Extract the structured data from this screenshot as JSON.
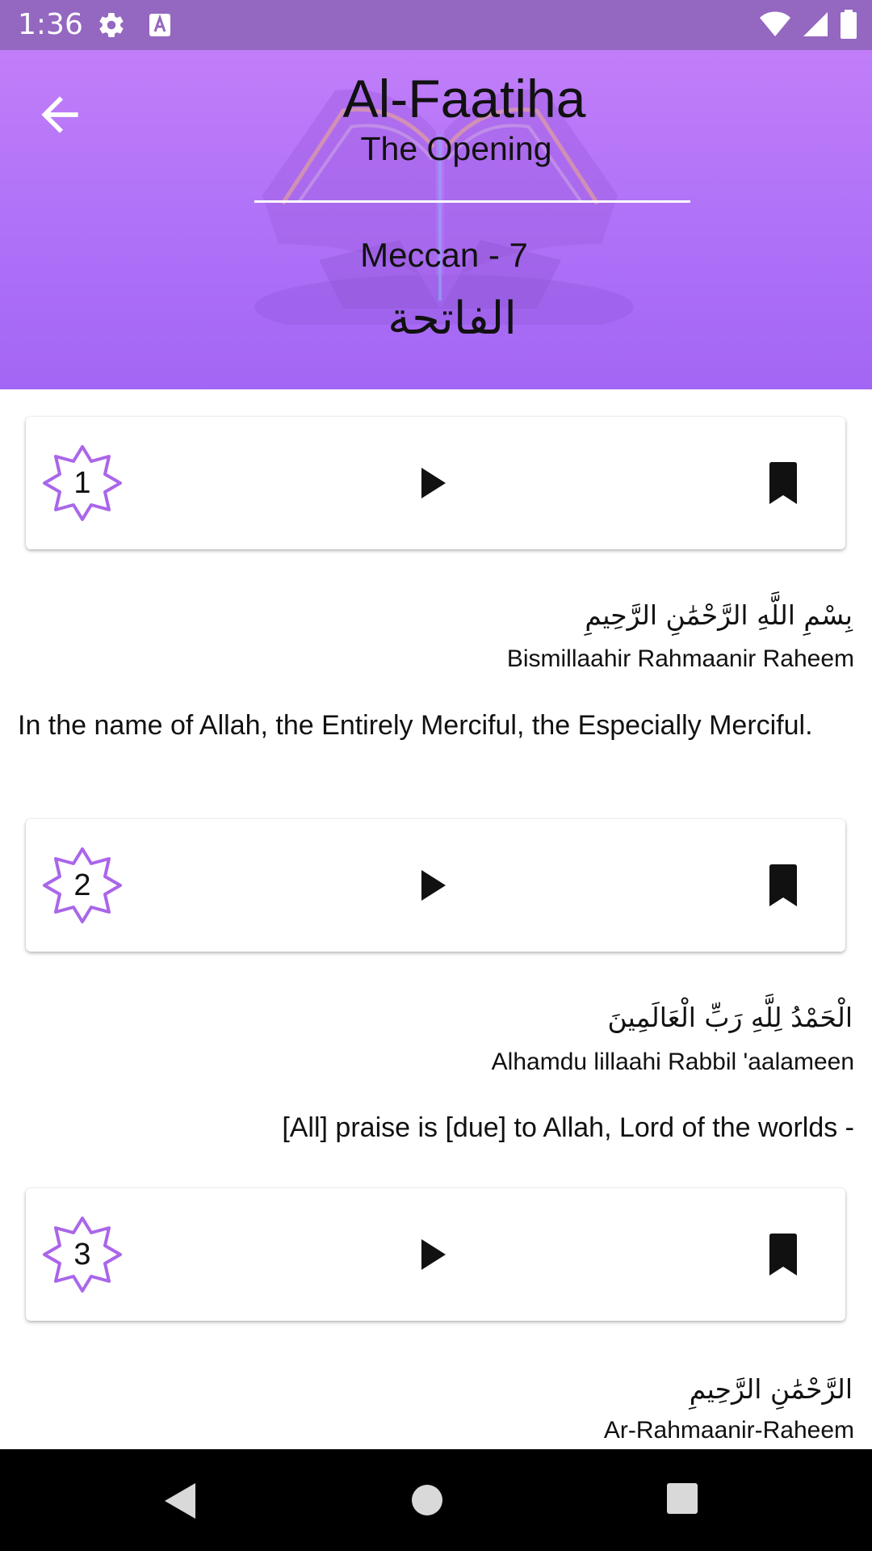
{
  "status_bar": {
    "time": "1:36",
    "icons": [
      "settings-icon",
      "keyboard-a-icon",
      "wifi-icon",
      "signal-icon",
      "battery-icon"
    ]
  },
  "header": {
    "title": "Al-Faatiha",
    "subtitle": "The Opening",
    "revelation_info": "Meccan - 7",
    "arabic_name": "الفاتحة",
    "back_icon": "arrow-back-icon",
    "background_icon": "open-book-icon"
  },
  "verses": [
    {
      "number": "1",
      "arabic": "بِسْمِ اللَّهِ الرَّحْمَٰنِ الرَّحِيمِ",
      "transliteration": "Bismillaahir Rahmaanir Raheem",
      "translation": "In the name of Allah, the Entirely Merciful, the Especially Merciful."
    },
    {
      "number": "2",
      "arabic": "الْحَمْدُ لِلَّهِ رَبِّ الْعَالَمِينَ",
      "transliteration": "Alhamdu lillaahi Rabbil 'aalameen",
      "translation": "[All] praise is [due] to Allah, Lord of the worlds -"
    },
    {
      "number": "3",
      "arabic": "الرَّحْمَٰنِ الرَّحِيمِ",
      "transliteration": "Ar-Rahmaanir-Raheem",
      "translation": ""
    }
  ],
  "verse_card_icons": {
    "badge": "eight-point-star-icon",
    "play": "play-icon",
    "bookmark": "bookmark-icon"
  },
  "nav_bar": {
    "icons": [
      "nav-back-icon",
      "nav-home-icon",
      "nav-recents-icon"
    ]
  },
  "colors": {
    "status_bar": "#9467c1",
    "header_top": "#c27ef9",
    "header_bottom": "#a366f4",
    "star_stroke": "#a155e8",
    "nav_bar": "#000000"
  }
}
